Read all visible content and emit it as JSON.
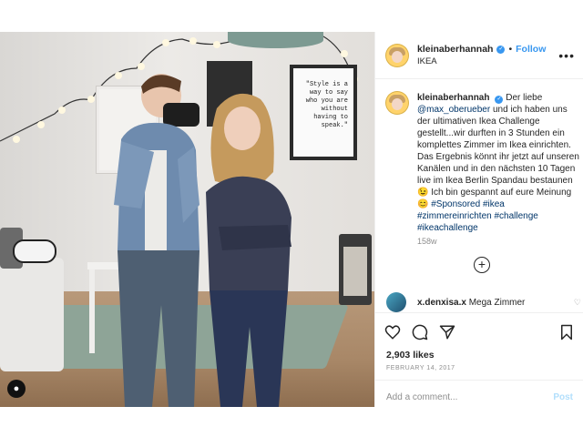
{
  "header": {
    "username": "kleinaberhannah",
    "separator": "•",
    "follow_label": "Follow",
    "location": "IKEA",
    "more_icon": "more-options-icon"
  },
  "photo": {
    "poster_text": "\"Style is a way to say who you are without having to speak.\"",
    "overlay_icon": "user-tag-icon"
  },
  "caption": {
    "username": "kleinaberhannah",
    "text_before_mention": "Der liebe",
    "mention": "@max_oberueber",
    "text_after_mention": "und ich haben uns der ultimativen Ikea Challenge gestellt...wir durften in 3 Stunden ein komplettes Zimmer im Ikea einrichten. Das Ergebnis könnt ihr jetzt auf unseren Kanälen und in den nächsten 10 Tagen live im Ikea Berlin Spandau bestaunen 😉 Ich bin gespannt auf eure Meinung 😊",
    "hashtags": "#Sponsored #ikea #zimmereinrichten #challenge #ikeachallenge",
    "time_ago": "158w"
  },
  "load_more_icon": "plus-circle-icon",
  "comments": [
    {
      "username": "x.denxisa.x",
      "text": "Mega Zimmer"
    }
  ],
  "actions": {
    "likes": "2,903 likes",
    "date": "FEBRUARY 14, 2017",
    "icons": [
      "heart-icon",
      "comment-icon",
      "share-icon",
      "bookmark-icon"
    ]
  },
  "add_comment": {
    "placeholder": "Add a comment...",
    "post_label": "Post"
  },
  "colors": {
    "accent": "#3897f0",
    "post_disabled": "#b2dffc",
    "muted": "#8e8e8e"
  }
}
